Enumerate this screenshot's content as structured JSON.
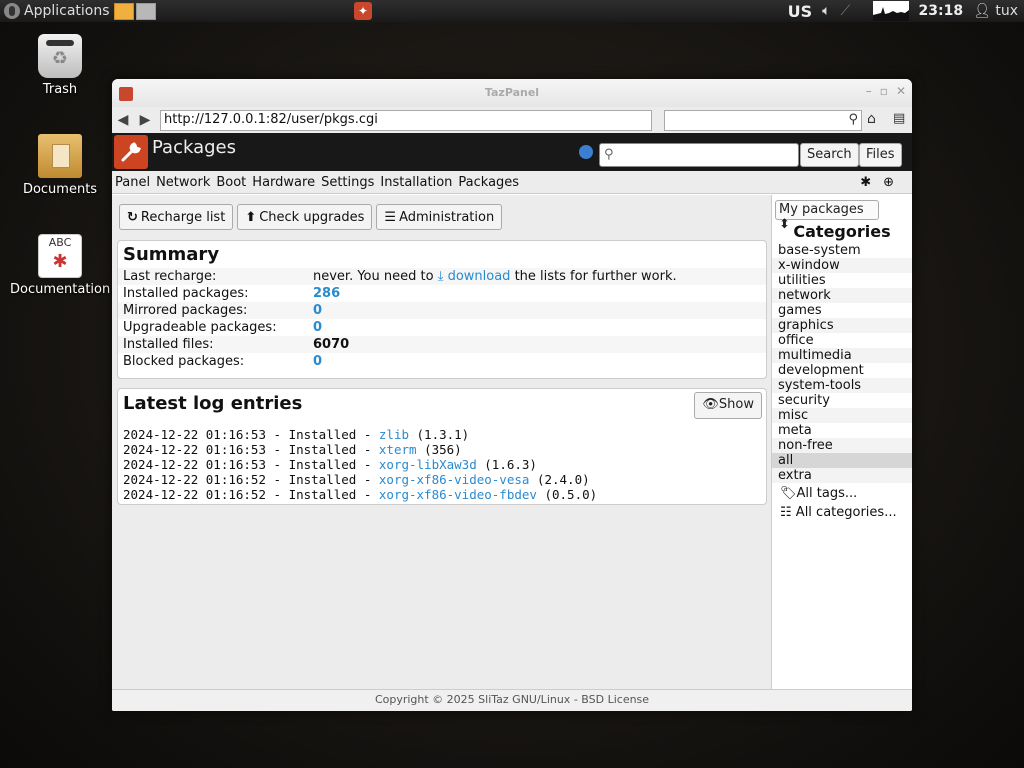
{
  "top_panel": {
    "applications_label": "Applications",
    "keyboard_layout": "US",
    "clock": "23:18",
    "user": "tux"
  },
  "desktop": {
    "icons": [
      {
        "label": "Trash"
      },
      {
        "label": "Documents"
      },
      {
        "label": "Documentation",
        "badge": "ABC"
      }
    ]
  },
  "window": {
    "title": "TazPanel",
    "url": "http://127.0.0.1:82/user/pkgs.cgi",
    "header": {
      "title": "Packages",
      "search_label": "Search",
      "files_label": "Files"
    },
    "menu": [
      "Panel",
      "Network",
      "Boot",
      "Hardware",
      "Settings",
      "Installation",
      "Packages"
    ],
    "toolbar": {
      "recharge": "Recharge list",
      "check_upgrades": "Check upgrades",
      "administration": "Administration"
    },
    "summary": {
      "heading": "Summary",
      "rows": [
        {
          "label": "Last recharge:",
          "value_pre": "never. You need to ",
          "value_link": "download",
          "value_post": " the lists for further work."
        },
        {
          "label": "Installed packages:",
          "value": "286"
        },
        {
          "label": "Mirrored packages:",
          "value": "0"
        },
        {
          "label": "Upgradeable packages:",
          "value": "0"
        },
        {
          "label": "Installed files:",
          "value": "6070"
        },
        {
          "label": "Blocked packages:",
          "value": "0"
        }
      ]
    },
    "logs": {
      "heading": "Latest log entries",
      "show_label": "Show",
      "entries": [
        {
          "time": "2024-12-22 01:16:53",
          "action": "Installed",
          "pkg": "zlib",
          "version": "(1.3.1)"
        },
        {
          "time": "2024-12-22 01:16:53",
          "action": "Installed",
          "pkg": "xterm",
          "version": "(356)"
        },
        {
          "time": "2024-12-22 01:16:53",
          "action": "Installed",
          "pkg": "xorg-libXaw3d",
          "version": "(1.6.3)"
        },
        {
          "time": "2024-12-22 01:16:52",
          "action": "Installed",
          "pkg": "xorg-xf86-video-vesa",
          "version": "(2.4.0)"
        },
        {
          "time": "2024-12-22 01:16:52",
          "action": "Installed",
          "pkg": "xorg-xf86-video-fbdev",
          "version": "(0.5.0)"
        }
      ]
    },
    "sidebar": {
      "select_value": "My packages",
      "heading": "Categories",
      "categories": [
        "base-system",
        "x-window",
        "utilities",
        "network",
        "games",
        "graphics",
        "office",
        "multimedia",
        "development",
        "system-tools",
        "security",
        "misc",
        "meta",
        "non-free",
        "all",
        "extra"
      ],
      "active_category": "all",
      "all_tags": "All tags...",
      "all_categories": "All categories..."
    },
    "footer": "Copyright © 2025 SliTaz GNU/Linux - BSD License"
  },
  "colors": {
    "link": "#2a8ad0",
    "header_bg": "#181818",
    "accent": "#c9472c"
  }
}
